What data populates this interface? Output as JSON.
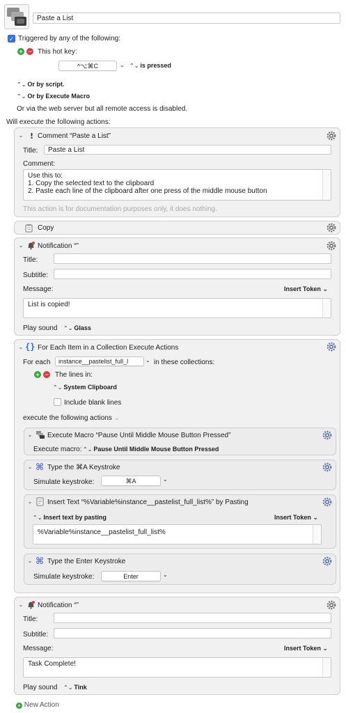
{
  "macro": {
    "name": "Paste a List"
  },
  "triggers": {
    "triggered_label": "Triggered by any of the following:",
    "hotkey_label": "This hot key:",
    "hotkey_value": "^⌥⌘C",
    "hotkey_state": "is pressed",
    "or_script": "Or by script.",
    "or_execute_macro": "Or by Execute Macro",
    "webserver_note": "Or via the web server but all remote access is disabled."
  },
  "actions_header": "Will execute the following actions:",
  "action_comment": {
    "header": "Comment “Paste a List”",
    "title_label": "Title:",
    "title_value": "Paste a List",
    "comment_label": "Comment:",
    "comment_line1": "Use this to:",
    "comment_line2": "1. Copy the selected text to the clipboard",
    "comment_line3": "2. Paste each line of the clipboard after one press of the middle mouse button",
    "note": "This action is for documentation purposes only, it does nothing."
  },
  "action_copy": {
    "header": "Copy"
  },
  "action_notification1": {
    "header": "Notification “”",
    "title_label": "Title:",
    "subtitle_label": "Subtitle:",
    "message_label": "Message:",
    "insert_token": "Insert Token",
    "message_value": "List is copied!",
    "play_sound_label": "Play sound",
    "sound_value": "Glass"
  },
  "action_foreach": {
    "header": "For Each Item in a Collection Execute Actions",
    "for_each_label": "For each",
    "variable_value": "instance__pastelist_full_l",
    "in_collections": "in these collections:",
    "lines_in": "The lines in:",
    "source_value": "System Clipboard",
    "include_blank": "Include blank lines",
    "execute_following": "execute the following actions",
    "sub_execute_macro": {
      "header": "Execute Macro “Pause Until Middle Mouse Button Pressed”",
      "execute_label": "Execute macro:",
      "macro_value": "Pause Until Middle Mouse Button Pressed"
    },
    "sub_type_a": {
      "header": "Type the ⌘A Keystroke",
      "simulate_label": "Simulate keystroke:",
      "keystroke_value": "⌘A"
    },
    "sub_insert_text": {
      "header": "Insert Text “%Variable%instance__pastelist_full_list%” by Pasting",
      "mode_value": "Insert text by pasting",
      "insert_token": "Insert Token",
      "text_value": "%Variable%instance__pastelist_full_list%"
    },
    "sub_type_enter": {
      "header": "Type the Enter Keystroke",
      "simulate_label": "Simulate keystroke:",
      "keystroke_value": "Enter"
    }
  },
  "action_notification2": {
    "header": "Notification “”",
    "title_label": "Title:",
    "subtitle_label": "Subtitle:",
    "message_label": "Message:",
    "insert_token": "Insert Token",
    "message_value": "Task Complete!",
    "play_sound_label": "Play sound",
    "sound_value": "Tink"
  },
  "new_action": "New Action",
  "colors": {
    "accent_blue": "#2f6fe8",
    "green": "#2eaa3a",
    "red": "#e0393e",
    "card_bg": "#f1f1f1"
  }
}
